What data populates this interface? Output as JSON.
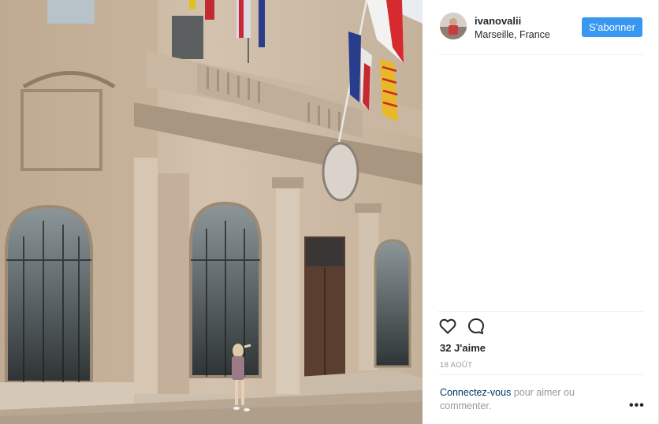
{
  "header": {
    "username": "ivanovalii",
    "location": "Marseille, France",
    "follow_label": "S'abonner"
  },
  "actions": {
    "likes": "32 J'aime",
    "date": "18 AOÛT"
  },
  "comment": {
    "login_link": "Connectez-vous",
    "login_rest": " pour aimer ou commenter.",
    "more": "•••"
  },
  "colors": {
    "accent": "#3897f0",
    "link": "#003569",
    "muted": "#999999",
    "text": "#262626"
  },
  "icons": [
    "heart-icon",
    "comment-icon",
    "more-options-icon"
  ]
}
